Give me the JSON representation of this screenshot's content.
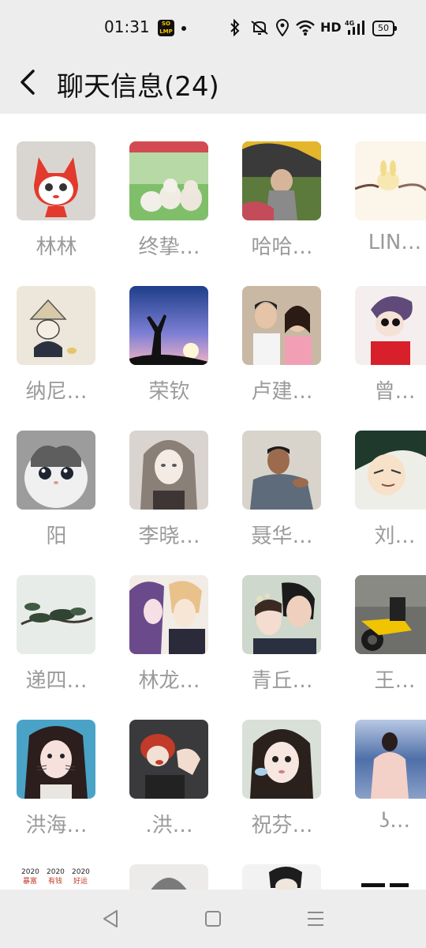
{
  "status_bar": {
    "time": "01:31",
    "app_icon_text": "SO\nLMP",
    "network_label": "HD",
    "network_type": "4G",
    "battery": "50"
  },
  "header": {
    "title": "聊天信息(24)"
  },
  "members": [
    {
      "name": "林林"
    },
    {
      "name": "终挚…"
    },
    {
      "name": "哈哈…"
    },
    {
      "name": "LIN…"
    },
    {
      "name": "纳尼…"
    },
    {
      "name": "荣钦"
    },
    {
      "name": "卢建…"
    },
    {
      "name": "曾…"
    },
    {
      "name": "阳"
    },
    {
      "name": "李晓…"
    },
    {
      "name": "聂华…"
    },
    {
      "name": "刘…"
    },
    {
      "name": "递四…"
    },
    {
      "name": "林龙…"
    },
    {
      "name": "青丘…"
    },
    {
      "name": "王…"
    },
    {
      "name": "洪海…"
    },
    {
      "name": ".洪…"
    },
    {
      "name": "祝芬…"
    },
    {
      "name": "ʖ…"
    },
    {
      "name": ""
    },
    {
      "name": ""
    },
    {
      "name": ""
    },
    {
      "name": ""
    }
  ],
  "partial_row_texts": {
    "tile1_years": [
      "2020",
      "2020",
      "2020"
    ],
    "tile1_words": [
      "暴富",
      "有钱",
      "好运"
    ]
  },
  "colors": {
    "bar_bg": "#ededed",
    "name_text": "#9a9a9a",
    "accent_yellow": "#f5c400"
  },
  "icons": {
    "back": "chevron-left-icon",
    "nav_back": "triangle-back-icon",
    "nav_home": "square-home-icon",
    "nav_menu": "menu-lines-icon"
  }
}
